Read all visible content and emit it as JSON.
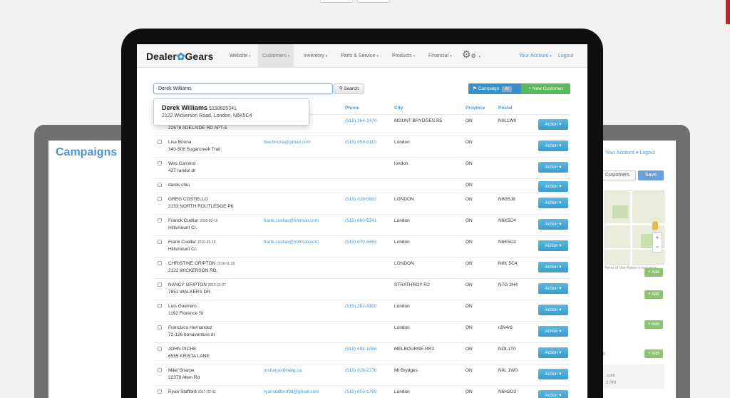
{
  "campaigns_title": "Campaigns",
  "back_right": {
    "account": "Your Account ▾  Logout",
    "customers_btn": "Customers",
    "save_btn": "Save",
    "map_terms": "Terms of Use   Report a map error",
    "add_label": "+ Add",
    "snippet_1": ".com",
    "snippet_2": "2 PM",
    "snippet_3": "0"
  },
  "navbar": {
    "logo_left": "Dealer",
    "logo_right": "Gears",
    "items": [
      {
        "label": "Website"
      },
      {
        "label": "Customers"
      },
      {
        "label": "Inventory"
      },
      {
        "label": "Parts & Service"
      },
      {
        "label": "Products"
      },
      {
        "label": "Financial"
      }
    ],
    "caret": "▾",
    "account": "Your Account",
    "logout": "Logout"
  },
  "search": {
    "value": "Derek Williams",
    "button": "Search",
    "search_icon": "search-icon"
  },
  "actions": {
    "campaign": "Campaign",
    "campaign_badge": "All",
    "new_customer": "+ New Customer"
  },
  "autocomplete": {
    "name": "Derek Williams",
    "phone": "5198605341",
    "address": "2122 Wickerson Road, London, N6K5C4"
  },
  "table": {
    "headers": {
      "phone": "Phone",
      "city": "City",
      "province": "Province",
      "postal": "Postal"
    },
    "action_label": "Action ▾",
    "rows": [
      {
        "name": "",
        "date": "",
        "address": "22678 ADELAIDE RD APT-5",
        "email": "",
        "phone": "(519) 264-2470",
        "city": "MOUNT BRYDGES R5",
        "province": "ON",
        "postal": "N0L1W0"
      },
      {
        "name": "Lisa Briona",
        "date": "",
        "address": "340-508 Sugarcreek Trail",
        "email": "lisa.briona@gmail.com",
        "phone": "(519) 359-6110",
        "city": "London",
        "province": "ON",
        "postal": ""
      },
      {
        "name": "Wes Carreiro",
        "date": "",
        "address": "427 randol dr",
        "email": "",
        "phone": "",
        "city": "london",
        "province": "ON",
        "postal": ""
      },
      {
        "name": "darek chiu",
        "date": "",
        "address": "",
        "email": "",
        "phone": "",
        "city": "",
        "province": "ON",
        "postal": ""
      },
      {
        "name": "GREG COSTELLO",
        "date": "",
        "address": "2153 NORTH ROUTLEDGE PK",
        "email": "",
        "phone": "(519) 319-5882",
        "city": "LONDON",
        "province": "ON",
        "postal": "N6G5J8"
      },
      {
        "name": "Franck Cuellar",
        "date": "2016-03-16",
        "address": "Hillsmount Cr.",
        "email": "frank.cuellar@hotmail.com",
        "phone": "(519) 860-5341",
        "city": "London",
        "province": "ON",
        "postal": "N6K5C4"
      },
      {
        "name": "Frank Cuellar",
        "date": "2016-03-16",
        "address": "Hillsmount Cr.",
        "email": "frank.cuellar@hotmail.com",
        "phone": "(519) 870-6363",
        "city": "London",
        "province": "ON",
        "postal": "N6K5C4"
      },
      {
        "name": "CHRISTINE GRIPTON",
        "date": "2016-11-26",
        "address": "2122 WICKERSON RD,",
        "email": "",
        "phone": "",
        "city": "LONDON",
        "province": "ON",
        "postal": "N6K 5C4"
      },
      {
        "name": "NANCY GRIPTON",
        "date": "2016-11-27",
        "address": "7851 WALKERS DR,",
        "email": "",
        "phone": "",
        "city": "STRATHROY R2",
        "province": "ON",
        "postal": "N7G 3H4"
      },
      {
        "name": "Luis Guerrero",
        "date": "",
        "address": "1192 Florence St",
        "email": "",
        "phone": "(519) 282-3300",
        "city": "London",
        "province": "ON",
        "postal": ""
      },
      {
        "name": "Francisco Hernandez",
        "date": "",
        "address": "72-126 bonaventure dr",
        "email": "",
        "phone": "",
        "city": "London",
        "province": "ON",
        "postal": "n5v4r6"
      },
      {
        "name": "JOHN PICHE",
        "date": "",
        "address": "6555 KRISTA LANE",
        "email": "",
        "phone": "(519) 494-1056",
        "city": "MELBOURNE RR3",
        "province": "ON",
        "postal": "NOL1T0"
      },
      {
        "name": "Mike Sharpe",
        "date": "",
        "address": "22378 Allen Rd",
        "email": "msharpe@tabg.ca",
        "phone": "(519) 319-2276",
        "city": "Mt Brydges",
        "province": "ON",
        "postal": "N0L 1W0"
      },
      {
        "name": "Ryan Stafford",
        "date": "2017-02-01",
        "address": "",
        "email": "ryanstafford99@gmail.com",
        "phone": "(519) 859-1799",
        "city": "London",
        "province": "ON",
        "postal": "N6H2G2"
      }
    ]
  }
}
